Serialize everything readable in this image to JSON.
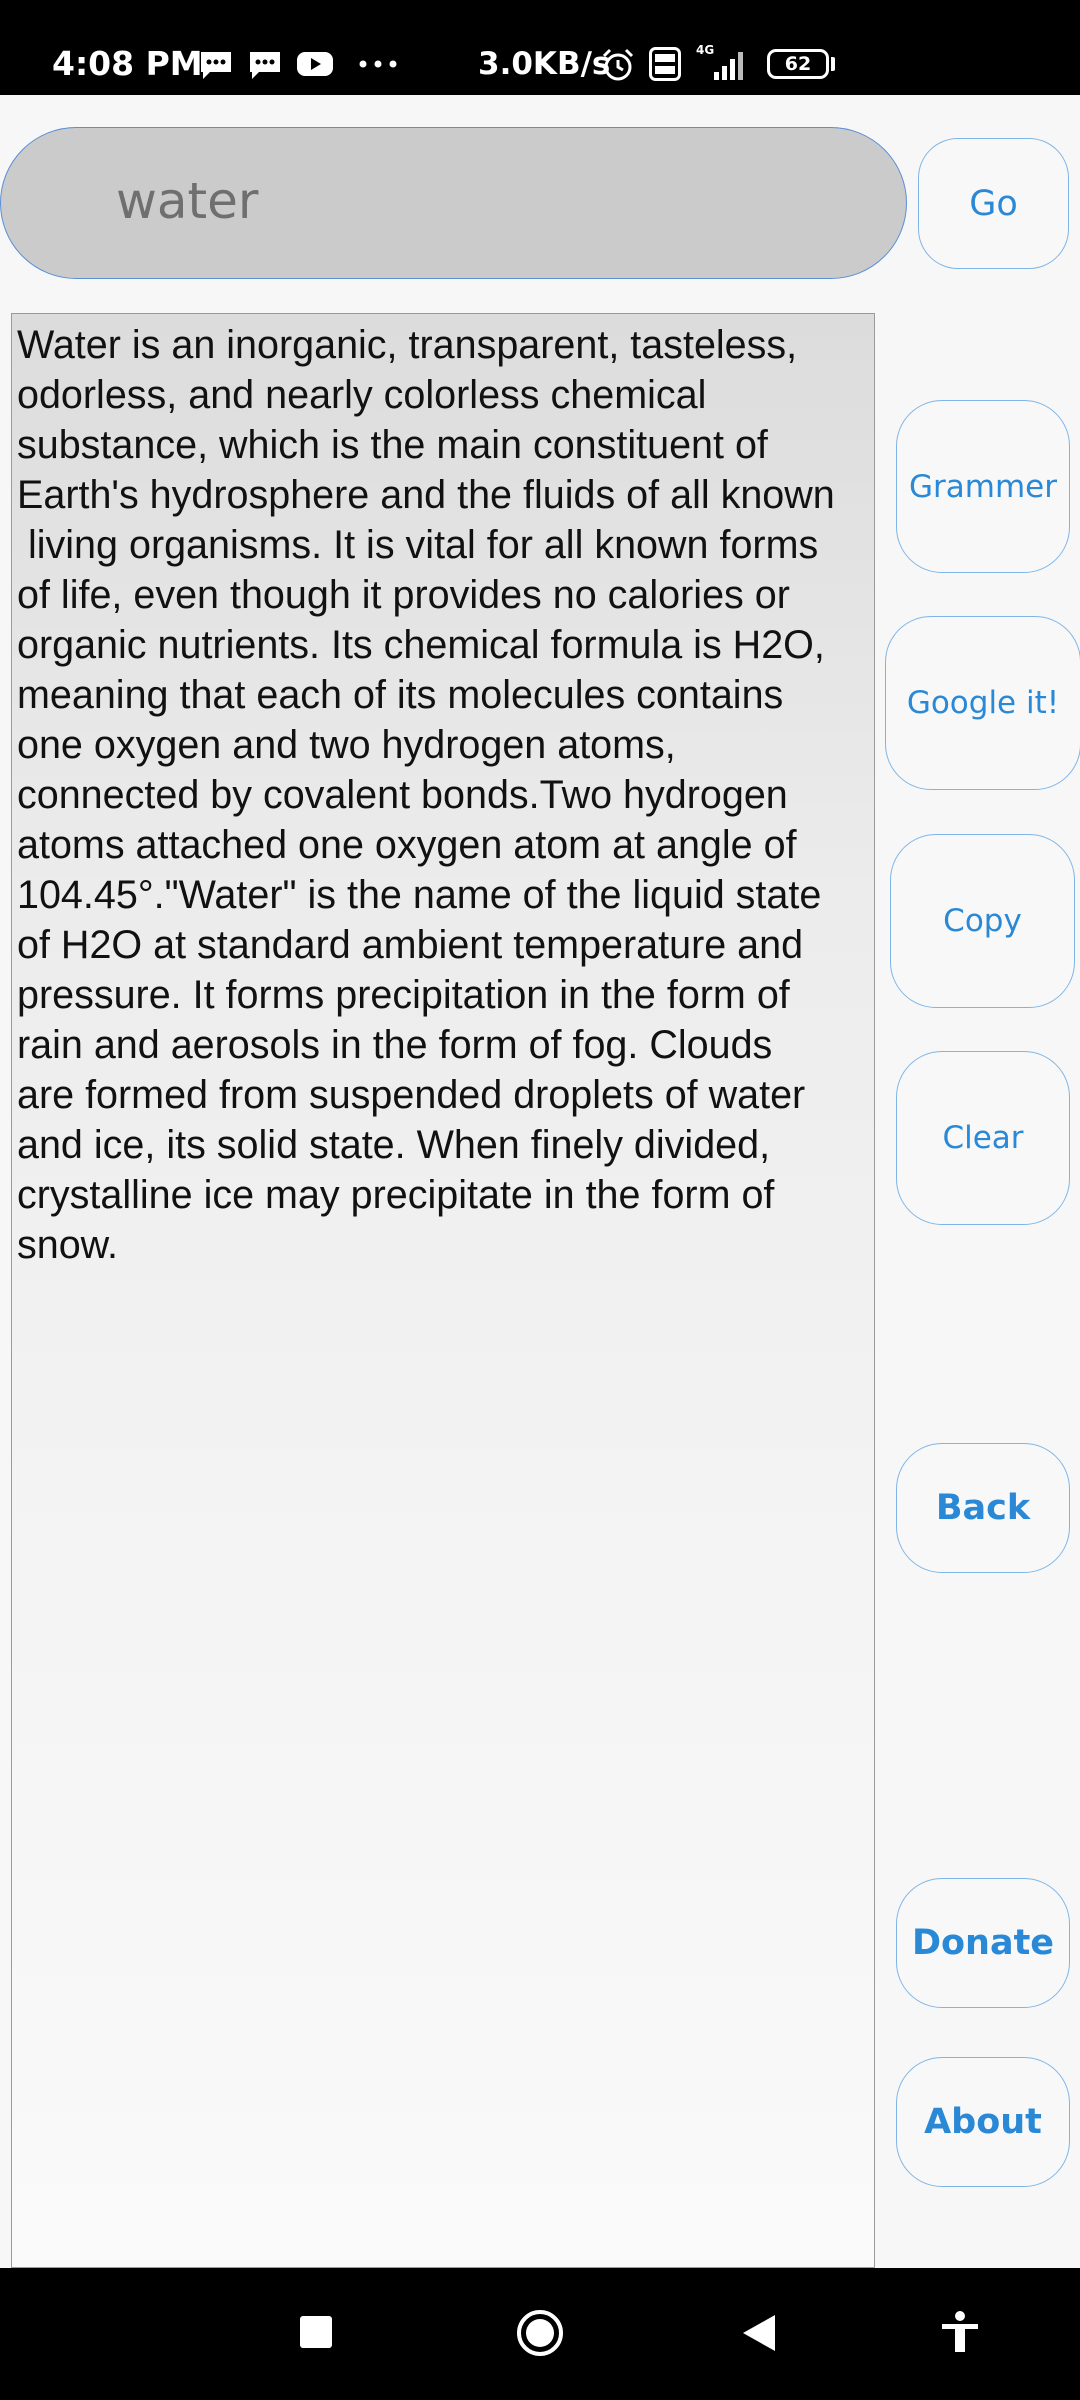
{
  "status_bar": {
    "time": "4:08 PM",
    "network_speed": "3.0KB/s",
    "battery_level": "62",
    "icons": [
      "chat-bubble-icon",
      "chat-bubble-icon",
      "youtube-icon",
      "more-dots-icon",
      "alarm-icon",
      "volte-icon",
      "signal-4g-icon",
      "battery-icon"
    ]
  },
  "search": {
    "value": "water"
  },
  "buttons": {
    "go": "Go",
    "grammer": "Grammer",
    "google": "Google it!",
    "copy": "Copy",
    "clear": "Clear",
    "back": "Back",
    "donate": "Donate",
    "about": "About"
  },
  "result": {
    "lines": [
      "Water is an inorganic, transparent, tasteless,",
      "odorless, and nearly colorless chemical",
      "substance, which is the main constituent of",
      "Earth's hydrosphere and the fluids of all known",
      " living organisms. It is vital for all known forms",
      "of life, even though it provides no calories or",
      "organic nutrients. Its chemical formula is H2O,",
      "meaning that each of its molecules contains",
      "one oxygen and two hydrogen atoms,",
      "connected by covalent bonds.Two hydrogen",
      "atoms attached one oxygen atom at angle of",
      "104.45°.\"Water\" is the name of the liquid state",
      "of H2O at standard ambient temperature and",
      "pressure. It forms precipitation in the form of",
      "rain and aerosols in the form of fog. Clouds",
      "are formed from suspended droplets of water",
      "and ice, its solid state. When finely divided,",
      "crystalline ice may precipitate in the form of",
      "snow."
    ]
  },
  "nav_bar": {
    "icons": [
      "recents-square-icon",
      "home-circle-icon",
      "back-triangle-icon",
      "accessibility-icon"
    ]
  },
  "colors": {
    "accent": "#2a89d6",
    "button_border": "#7fb5e6",
    "search_fill": "#cbcbcb",
    "search_border": "#5a8fd6",
    "page_background": "#f7f7f7"
  }
}
